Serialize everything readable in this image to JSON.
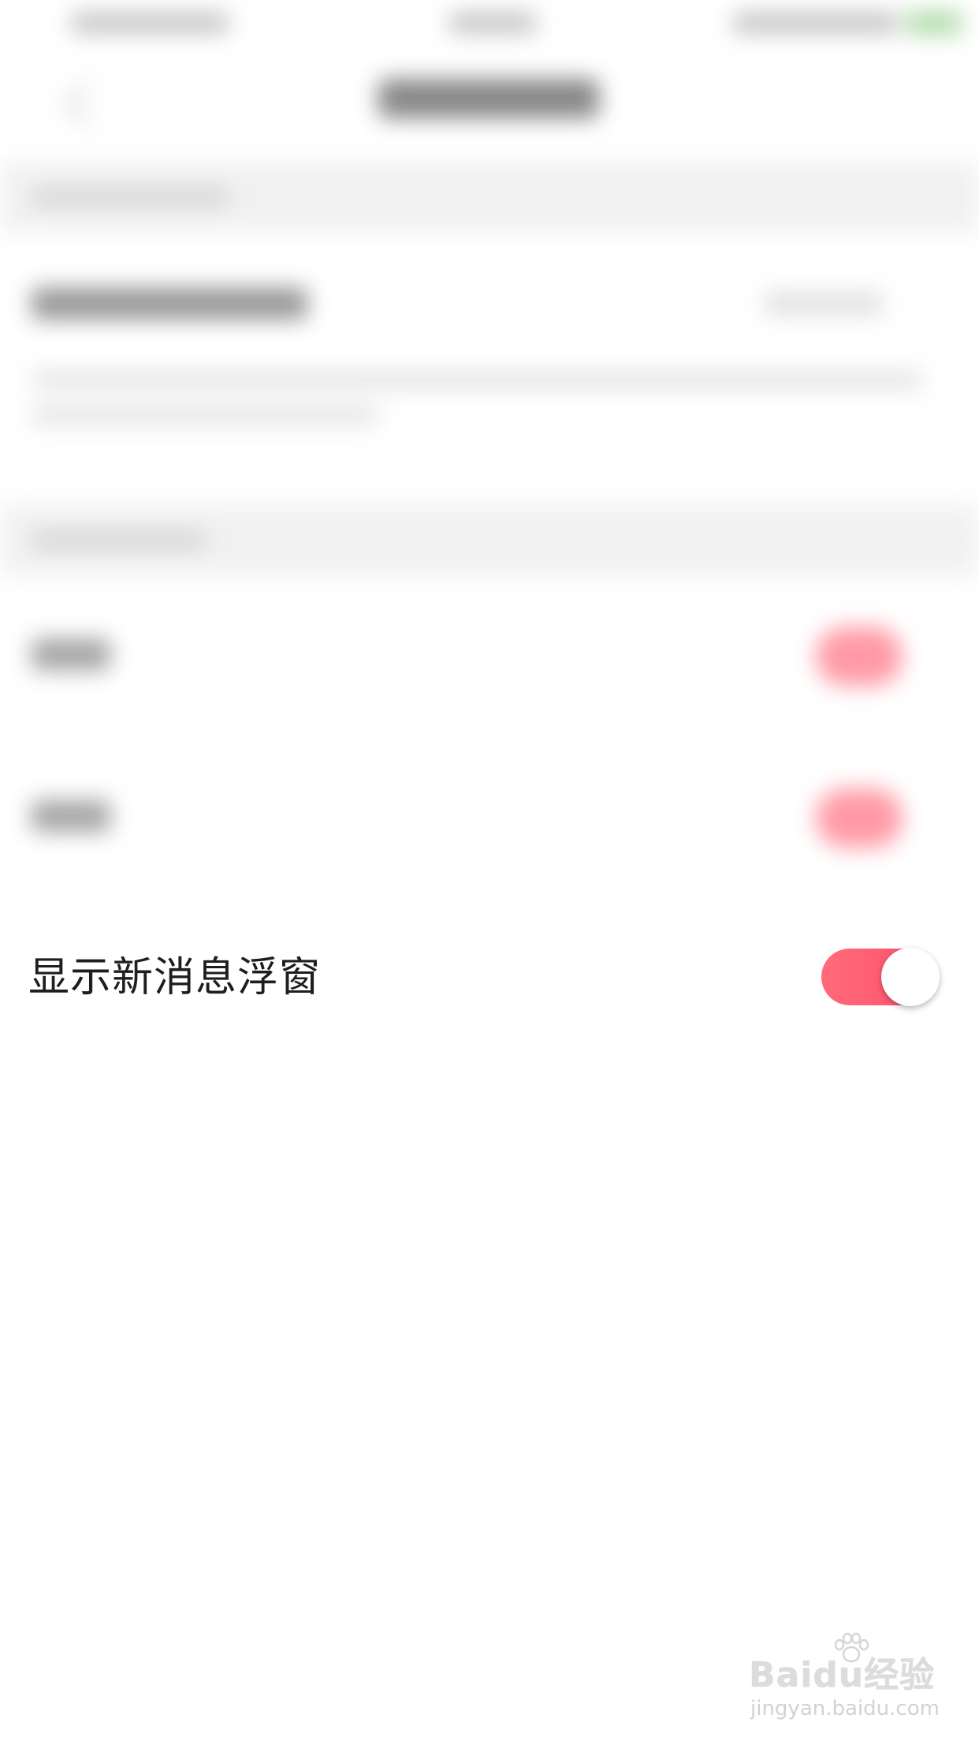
{
  "settings": {
    "floating_window": {
      "label": "显示新消息浮窗",
      "enabled": true,
      "accent_color": "#ff5a6e"
    }
  },
  "watermark": {
    "logo_text": "Baidu经验",
    "url_text": "jingyan.baidu.com"
  }
}
